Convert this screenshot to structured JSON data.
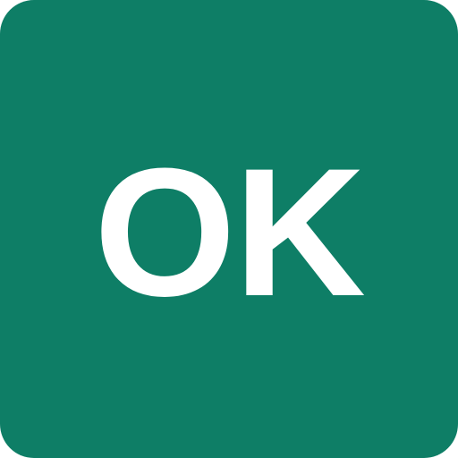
{
  "button": {
    "label": "OK",
    "background_color": "#0e7e66",
    "text_color": "#ffffff"
  }
}
